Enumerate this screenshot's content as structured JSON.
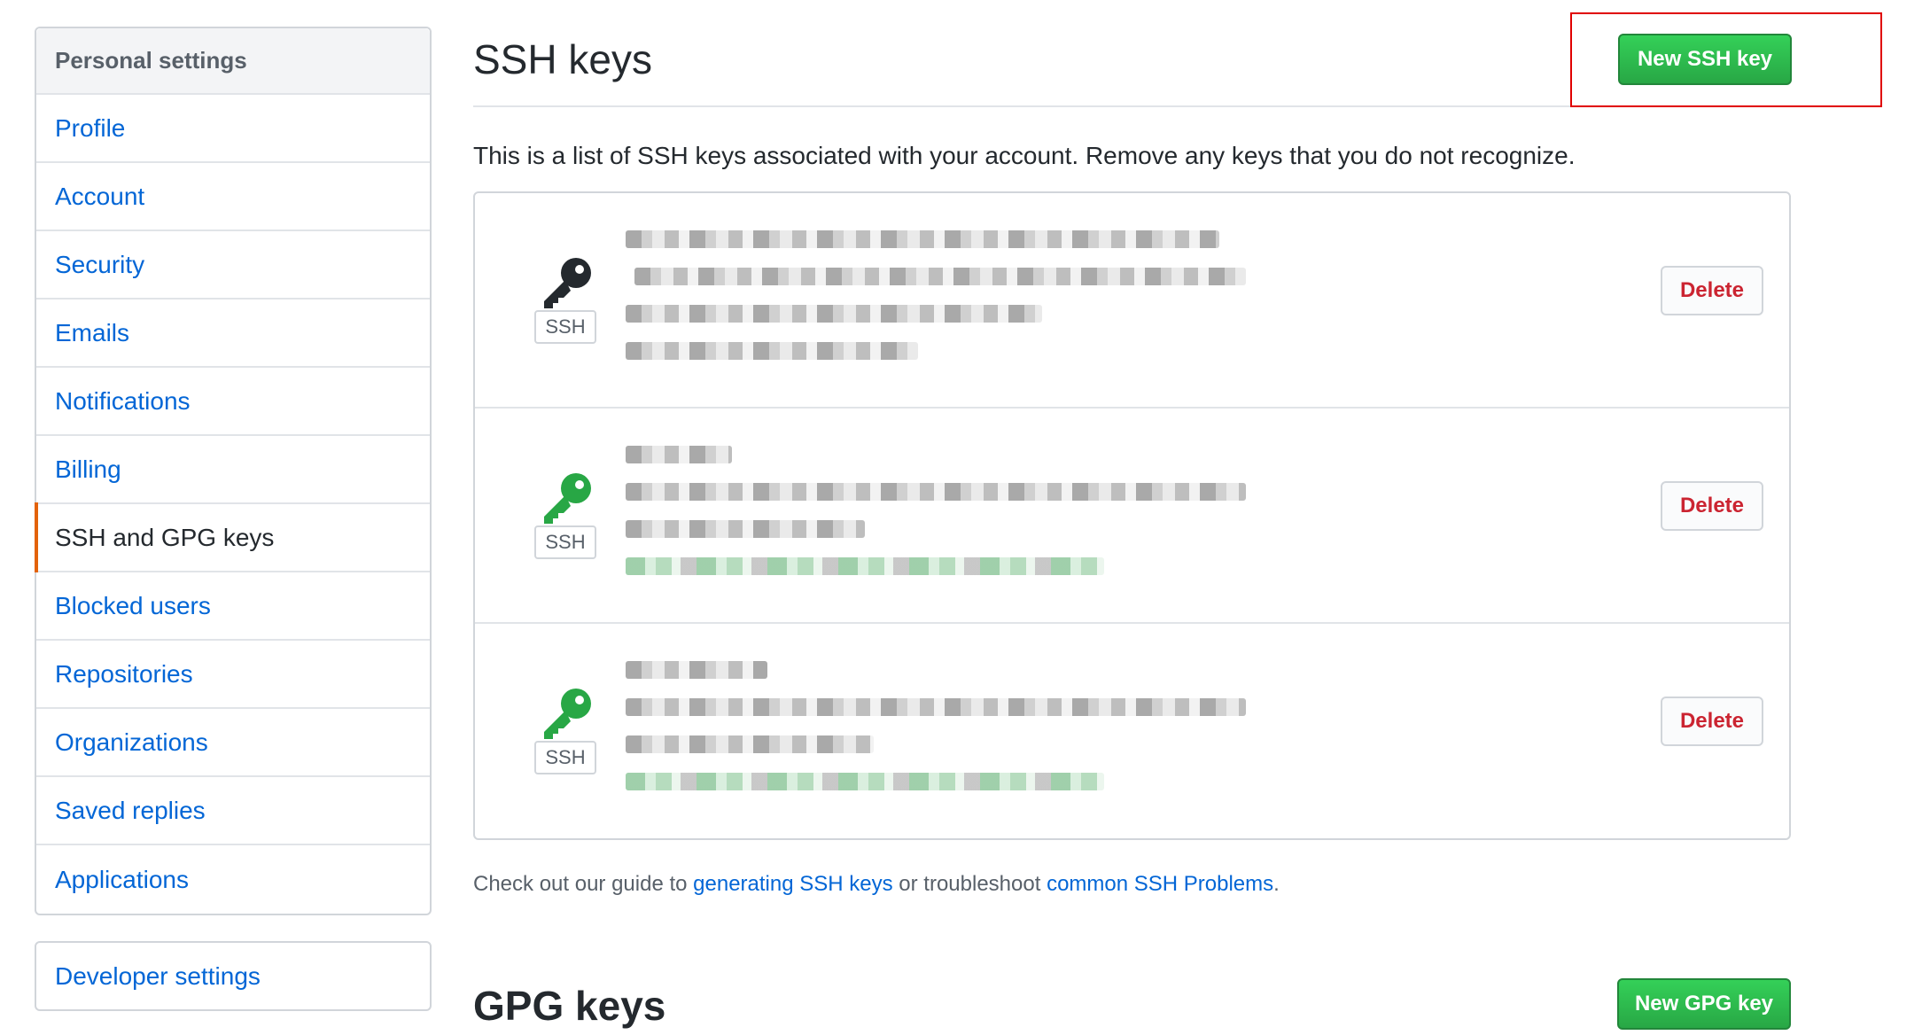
{
  "sidebar": {
    "header": "Personal settings",
    "items": [
      {
        "label": "Profile"
      },
      {
        "label": "Account"
      },
      {
        "label": "Security"
      },
      {
        "label": "Emails"
      },
      {
        "label": "Notifications"
      },
      {
        "label": "Billing"
      },
      {
        "label": "SSH and GPG keys",
        "active": true
      },
      {
        "label": "Blocked users"
      },
      {
        "label": "Repositories"
      },
      {
        "label": "Organizations"
      },
      {
        "label": "Saved replies"
      },
      {
        "label": "Applications"
      }
    ],
    "developer_settings": "Developer settings"
  },
  "ssh": {
    "title": "SSH keys",
    "new_button": "New SSH key",
    "description": "This is a list of SSH keys associated with your account. Remove any keys that you do not recognize.",
    "keys": [
      {
        "badge": "SSH",
        "delete_label": "Delete",
        "icon_color": "#24292e",
        "recently_used": false
      },
      {
        "badge": "SSH",
        "delete_label": "Delete",
        "icon_color": "#28a745",
        "recently_used": true
      },
      {
        "badge": "SSH",
        "delete_label": "Delete",
        "icon_color": "#28a745",
        "recently_used": true
      }
    ],
    "guide": {
      "prefix": "Check out our guide to ",
      "link1": "generating SSH keys",
      "middle": " or troubleshoot ",
      "link2": "common SSH Problems",
      "suffix": "."
    }
  },
  "gpg": {
    "title": "GPG keys",
    "new_button": "New GPG key"
  },
  "colors": {
    "link": "#0366d6",
    "active_indicator": "#e36209",
    "primary_button": "#28a745",
    "danger": "#cb2431",
    "highlight_box": "#e00000"
  }
}
